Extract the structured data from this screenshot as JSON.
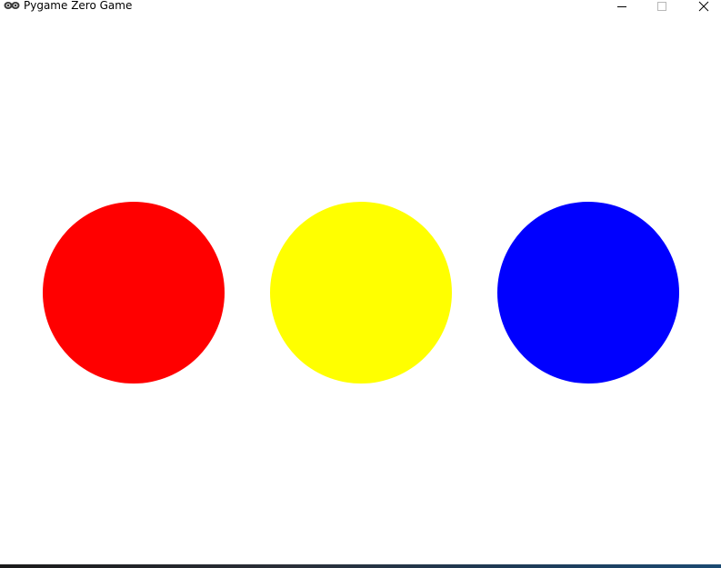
{
  "window": {
    "title": "Pygame Zero Game",
    "icon": "pygame-snake-icon",
    "controls": {
      "minimize_icon": "minimize-icon",
      "maximize_icon": "maximize-icon",
      "close_icon": "close-icon"
    }
  },
  "game": {
    "background_color": "#ffffff",
    "circles": [
      {
        "name": "red-circle",
        "color": "#ff0000"
      },
      {
        "name": "yellow-circle",
        "color": "#ffff00"
      },
      {
        "name": "blue-circle",
        "color": "#0000ff"
      }
    ]
  }
}
